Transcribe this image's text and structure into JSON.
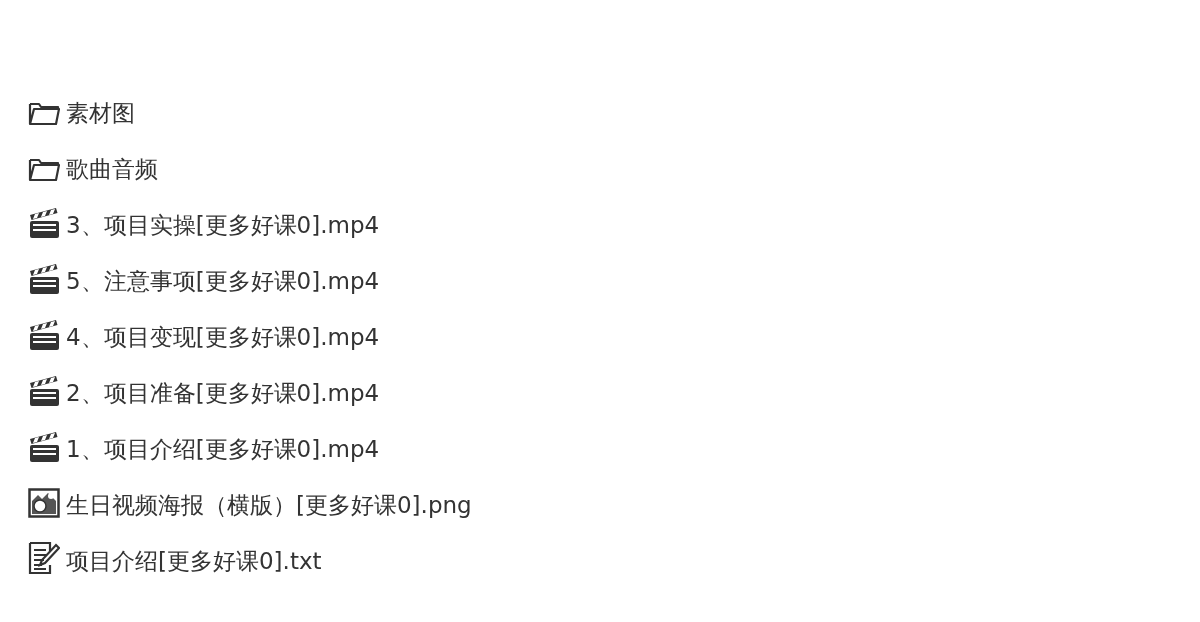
{
  "files": [
    {
      "kind": "folder",
      "name": "素材图"
    },
    {
      "kind": "folder",
      "name": "歌曲音频"
    },
    {
      "kind": "video",
      "name": "3、项目实操[更多好课0].mp4"
    },
    {
      "kind": "video",
      "name": "5、注意事项[更多好课0].mp4"
    },
    {
      "kind": "video",
      "name": "4、项目变现[更多好课0].mp4"
    },
    {
      "kind": "video",
      "name": "2、项目准备[更多好课0].mp4"
    },
    {
      "kind": "video",
      "name": "1、项目介绍[更多好课0].mp4"
    },
    {
      "kind": "image",
      "name": "生日视频海报（横版）[更多好课0].png"
    },
    {
      "kind": "text",
      "name": "项目介绍[更多好课0].txt"
    }
  ]
}
